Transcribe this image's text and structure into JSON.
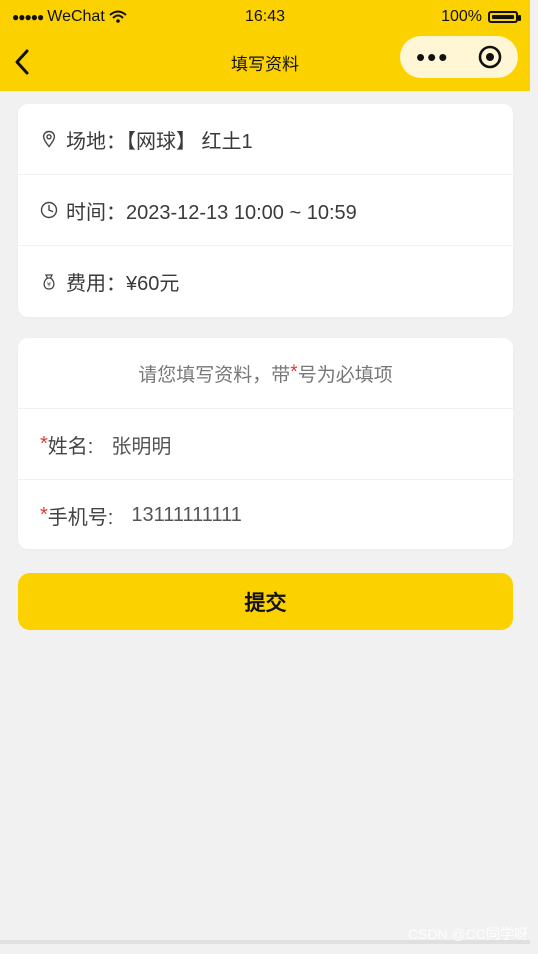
{
  "status": {
    "carrier": "WeChat",
    "time": "16:43",
    "battery": "100%"
  },
  "nav": {
    "title": "填写资料"
  },
  "info": {
    "venue": "场地：【网球】 红土1",
    "time": "时间：2023-12-13 10:00 ~ 10:59",
    "fee": "费用：¥60元"
  },
  "form": {
    "hint_before": "请您填写资料，带",
    "hint_star": "*",
    "hint_after": "号为必填项",
    "name_star": "*",
    "name_label": "姓名:",
    "name_value": "张明明",
    "phone_star": "*",
    "phone_label": "手机号:",
    "phone_value": "13111111111"
  },
  "submit_label": "提交",
  "watermark": "CSDN @CC同学呀",
  "colors": {
    "accent": "#fcd100",
    "required_star": "#e53935",
    "background": "#f1f1f1"
  },
  "icons": {
    "venue": "location-pin-icon",
    "time": "clock-icon",
    "fee": "money-bag-icon",
    "back": "back-arrow-icon",
    "more": "more-dots-icon",
    "close": "close-circle-icon"
  }
}
